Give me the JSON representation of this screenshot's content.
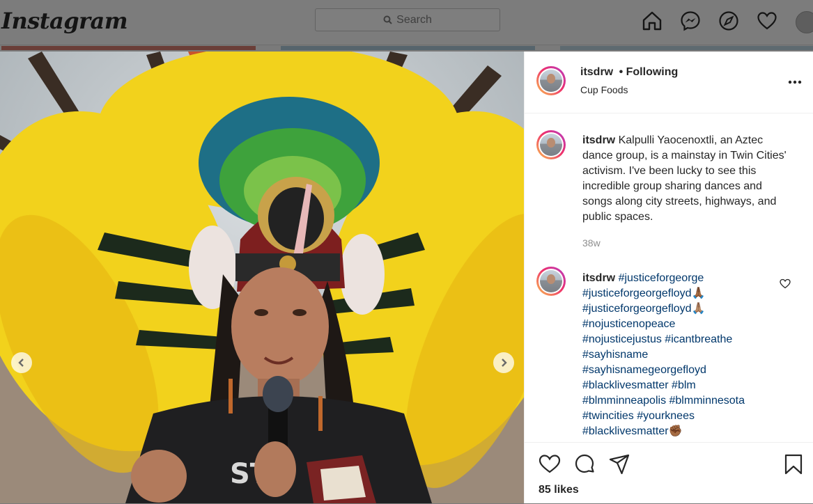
{
  "app": {
    "logo_text": "Instagram"
  },
  "topbar": {
    "search_placeholder": "Search",
    "nav_icons": [
      "home-icon",
      "messenger-icon",
      "explore-icon",
      "activity-heart-icon",
      "profile-avatar"
    ]
  },
  "post": {
    "username": "itsdrw",
    "follow_status": "• Following",
    "location": "Cup Foods",
    "caption": {
      "username": "itsdrw",
      "text": "Kalpulli Yaocenoxtli, an Aztec dance group, is a mainstay in Twin Cities' activism. I've been lucky to see this incredible group sharing dances and songs along city streets, highways, and public spaces.",
      "time": "38w"
    },
    "comment": {
      "username": "itsdrw",
      "hashtags": [
        "#justiceforgeorge",
        "#justiceforgeorgefloyd🙏🏾",
        "#justiceforgeorgefloyd🙏🏽",
        "#nojusticenopeace",
        "#nojusticejustus #icantbreathe",
        "#sayhisname",
        "#sayhisnamegeorgefloyd",
        "#blacklivesmatter #blm",
        "#blmminneapolis #blmminnesota",
        "#twincities #yourknees",
        "#blacklivesmatter✊🏾"
      ]
    },
    "likes": "85 likes"
  },
  "colors": {
    "link": "#00376b",
    "text": "#262626",
    "muted": "#8e8e8e",
    "story_ring": [
      "#f9c24f",
      "#ee2f6c",
      "#b43ec6"
    ]
  }
}
